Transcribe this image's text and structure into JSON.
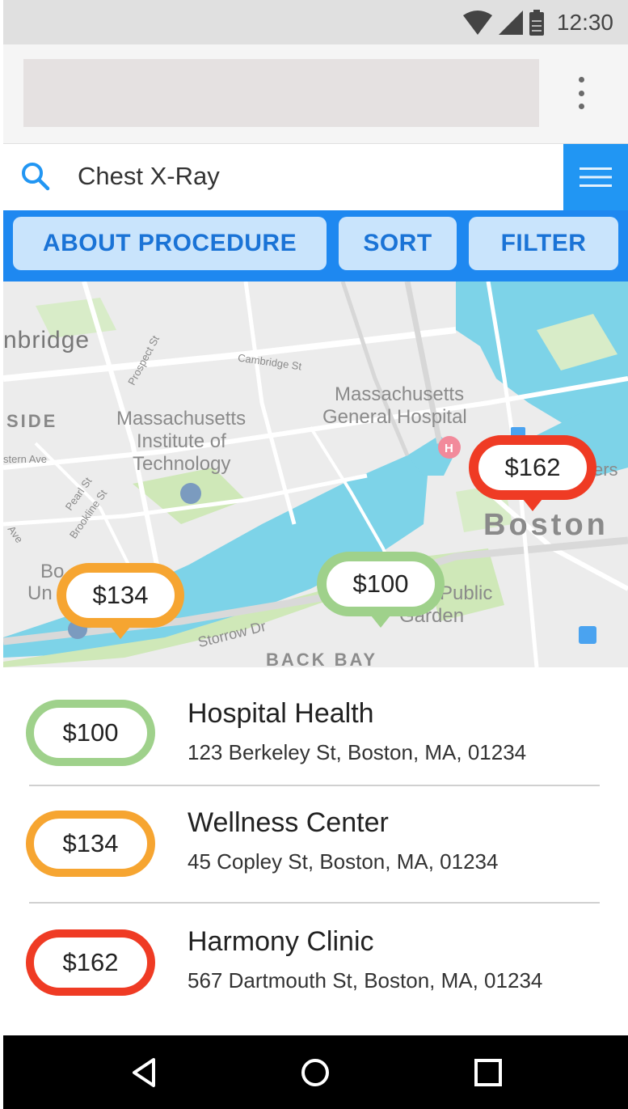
{
  "status_bar": {
    "time": "12:30",
    "icons": [
      "wifi-icon",
      "cellular-signal-icon",
      "battery-icon"
    ]
  },
  "browser": {
    "menu_icon": "vertical-dots-icon"
  },
  "search": {
    "value": "Chest X-Ray",
    "icon": "search-icon",
    "menu_icon": "hamburger-menu-icon"
  },
  "actions": {
    "about_label": "ABOUT PROCEDURE",
    "sort_label": "SORT",
    "filter_label": "FILTER"
  },
  "map": {
    "labels": {
      "cambridge": "nbridge",
      "side": "SIDE",
      "prospect": "Prospect St",
      "cambridge_st": "Cambridge St",
      "mgh1": "Massachusetts",
      "mgh2": "General Hospital",
      "mit1": "Massachusetts",
      "mit2": "Institute of",
      "mit3": "Technology",
      "western": "stern Ave",
      "pearl": "Pearl St",
      "brookline": "Brookline St",
      "ave": "Ave",
      "bo": "Bo",
      "un": "Un",
      "boston": "Boston",
      "public1": "Public",
      "public2": "Garden",
      "storrow": "Storrow Dr",
      "backbay": "BACK BAY",
      "ers": "ers"
    },
    "pins": [
      {
        "price": "$162",
        "color": "#ef3b24"
      },
      {
        "price": "$134",
        "color": "#f6a531"
      },
      {
        "price": "$100",
        "color": "#9fd18b"
      }
    ]
  },
  "colors": {
    "primary": "#2196f3",
    "button_bg": "#c9e4fc",
    "button_text": "#1a73d6",
    "green": "#9fd18b",
    "orange": "#f6a531",
    "red": "#ef3b24",
    "water": "#7dd3e8",
    "park": "#cfe8b8"
  },
  "results": [
    {
      "price": "$100",
      "name": "Hospital Health",
      "address": "123 Berkeley St, Boston, MA, 01234",
      "color": "#9fd18b"
    },
    {
      "price": "$134",
      "name": "Wellness Center",
      "address": "45 Copley St, Boston, MA, 01234",
      "color": "#f6a531"
    },
    {
      "price": "$162",
      "name": "Harmony Clinic",
      "address": "567 Dartmouth St, Boston, MA, 01234",
      "color": "#ef3b24"
    }
  ],
  "nav": {
    "back_icon": "back-triangle-icon",
    "home_icon": "home-circle-icon",
    "recents_icon": "recents-square-icon"
  }
}
